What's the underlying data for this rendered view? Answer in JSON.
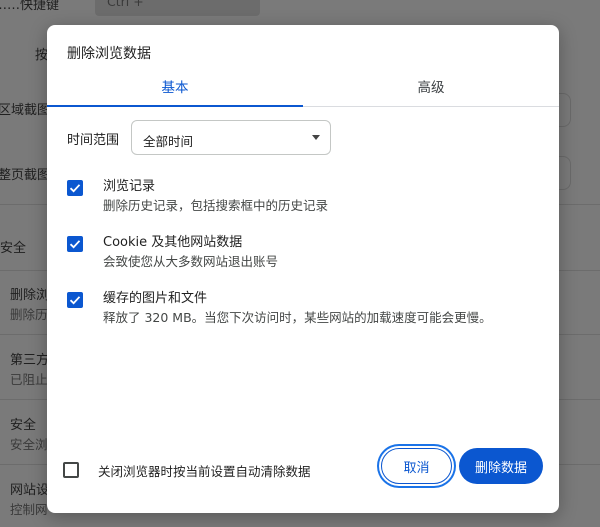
{
  "background": {
    "items": [
      {
        "text": "……快捷键"
      },
      {
        "text": "按"
      },
      {
        "text": "区域截图"
      },
      {
        "text": "整页截图"
      },
      {
        "text": "安全"
      },
      {
        "text": "删除浏"
      },
      {
        "text": "删除历"
      },
      {
        "text": "第三方"
      },
      {
        "text": "已阻止"
      },
      {
        "text": "安全"
      },
      {
        "text": "安全浏"
      },
      {
        "text": "网站设"
      },
      {
        "text": "控制网"
      }
    ],
    "field_text": "Ctrl +"
  },
  "dialog": {
    "title": "删除浏览数据",
    "tabs": [
      {
        "label": "基本",
        "active": true
      },
      {
        "label": "高级",
        "active": false
      }
    ],
    "time_range": {
      "label": "时间范围",
      "value": "全部时间"
    },
    "options": [
      {
        "title": "浏览记录",
        "description": "删除历史记录，包括搜索框中的历史记录",
        "checked": true
      },
      {
        "title": "Cookie 及其他网站数据",
        "description": "会致使您从大多数网站退出账号",
        "checked": true
      },
      {
        "title": "缓存的图片和文件",
        "description": "释放了 320 MB。当您下次访问时，某些网站的加载速度可能会更慢。",
        "checked": true
      }
    ],
    "footer_checkbox": {
      "label": "关闭浏览器时按当前设置自动清除数据",
      "checked": false
    },
    "cancel_label": "取消",
    "delete_label": "删除数据"
  },
  "colors": {
    "accent": "#0b57d0",
    "overlay": "#7a7a7a"
  }
}
